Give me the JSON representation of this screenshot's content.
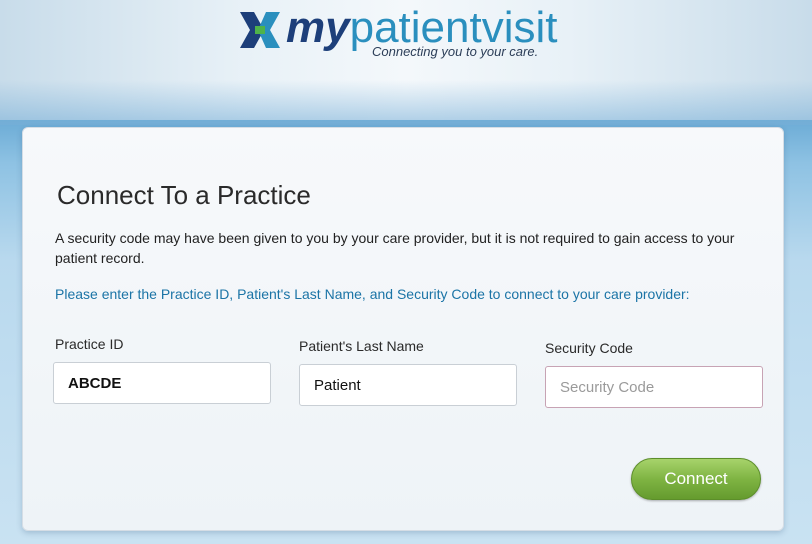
{
  "brand": {
    "logo_my": "my",
    "logo_rest": "patientvisit",
    "tagline": "Connecting you to your care."
  },
  "form": {
    "title": "Connect To a Practice",
    "description": "A security code may have been given to you by your care provider, but it is not required to gain access to your patient record.",
    "instructions": "Please enter the Practice ID, Patient's Last Name, and Security Code to connect to your care provider:",
    "fields": [
      {
        "label": "Practice ID",
        "value": "ABCDE",
        "placeholder": ""
      },
      {
        "label": "Patient's Last Name",
        "value": "Patient",
        "placeholder": ""
      },
      {
        "label": "Security Code",
        "value": "",
        "placeholder": "Security Code"
      }
    ],
    "connect_label": "Connect"
  },
  "colors": {
    "accent_blue": "#1b74a6",
    "brand_navy": "#1d3f7a",
    "button_green": "#7fb443"
  }
}
